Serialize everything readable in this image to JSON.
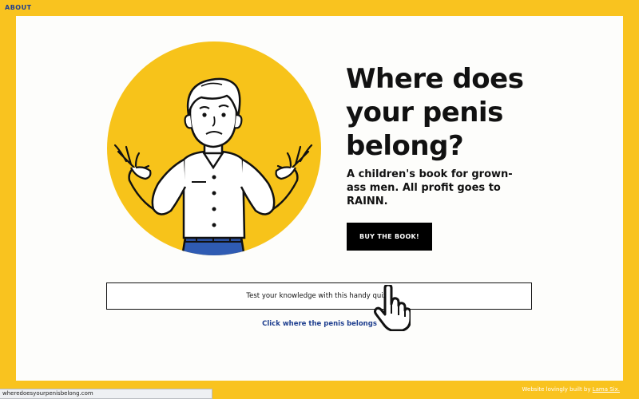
{
  "nav": {
    "about": "ABOUT"
  },
  "hero": {
    "headline_lines": [
      "Where does",
      "your penis",
      "belong?"
    ],
    "subtitle": "A children's book for grown-ass men. All profit goes to RAINN.",
    "buy_button": "BUY THE BOOK!"
  },
  "quiz": {
    "text": "Test your knowledge with this handy quiz",
    "caret": "▾",
    "click_prompt": "Click where the penis belongs"
  },
  "footer": {
    "status_url": "wheredoesyourpenisbelong.com",
    "credit_prefix": "Website lovingly built by ",
    "credit_link": "Lama Six."
  },
  "colors": {
    "background": "#f9c31f",
    "panel": "#fdfdfb",
    "circle": "#f7c31a",
    "link": "#1f3f8f",
    "button": "#000000"
  },
  "icons": [
    "pointer-hand-icon",
    "caret-down-icon"
  ]
}
